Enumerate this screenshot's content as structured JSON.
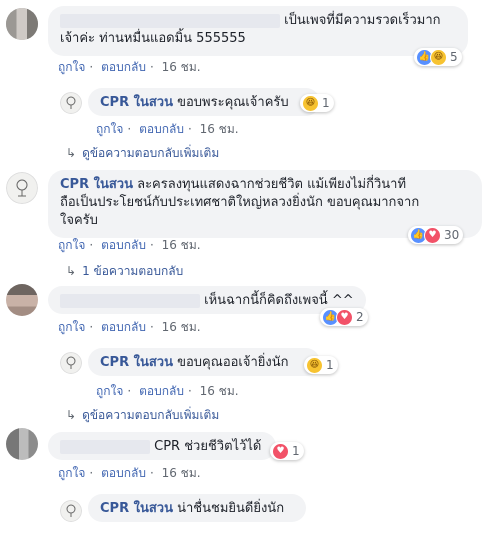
{
  "c1": {
    "text": "เป็นเพจที่มีความรวดเร็วมาก\nเจ้าค่ะ ท่านหมื่นแอดมิ้น 555555",
    "like": "ถูกใจ",
    "reply": "ตอบกลับ",
    "time": "16 ชม.",
    "reactions": [
      "like-icon",
      "haha-icon"
    ],
    "count": "5"
  },
  "r1": {
    "author": "CPR ในสวน",
    "text": "ขอบพระคุณเจ้าครับ",
    "like": "ถูกใจ",
    "reply": "ตอบกลับ",
    "time": "16 ชม.",
    "reactions": [
      "haha-icon"
    ],
    "count": "1"
  },
  "more1": "ดูข้อความตอบกลับเพิ่มเติม",
  "c2": {
    "author": "CPR ในสวน",
    "text": "ละครลงทุนแสดงฉากช่วยชีวิต แม้เพียงไม่กี่วินาที\nถือเป็นประโยชน์กับประเทศชาติใหญ่หลวงยิ่งนัก ขอบคุณมากจาก\nใจครับ",
    "like": "ถูกใจ",
    "reply": "ตอบกลับ",
    "time": "16 ชม.",
    "reactions": [
      "like-icon",
      "love-icon"
    ],
    "count": "30"
  },
  "more2": "1 ข้อความตอบกลับ",
  "c3": {
    "text": "เห็นฉากนี้ก็คิดถึงเพจนี้ ^^",
    "like": "ถูกใจ",
    "reply": "ตอบกลับ",
    "time": "16 ชม.",
    "reactions": [
      "like-icon",
      "love-icon"
    ],
    "count": "2"
  },
  "r3": {
    "author": "CPR ในสวน",
    "text": "ขอบคุณออเจ้ายิ่งนัก",
    "like": "ถูกใจ",
    "reply": "ตอบกลับ",
    "time": "16 ชม.",
    "reactions": [
      "haha-icon"
    ],
    "count": "1"
  },
  "more3": "ดูข้อความตอบกลับเพิ่มเติม",
  "c4": {
    "text": "CPR ช่วยชีวิตไว้ได้",
    "like": "ถูกใจ",
    "reply": "ตอบกลับ",
    "time": "16 ชม.",
    "reactions": [
      "love-icon"
    ],
    "count": "1"
  },
  "r4": {
    "author": "CPR ในสวน",
    "text": "น่าชื่นชมยินดียิ่งนัก"
  },
  "sep": "·",
  "colors": {
    "name": "#385898",
    "bubble": "#f2f3f5",
    "like": "#5890ff",
    "love": "#f25268",
    "haha": "#f7c331"
  }
}
